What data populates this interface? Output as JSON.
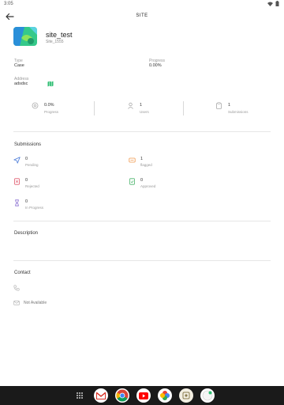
{
  "status_bar": {
    "time": "3:05"
  },
  "app_bar": {
    "title": "SITE"
  },
  "site": {
    "name": "site_test",
    "identifier": "Site_1555",
    "type_label": "Type",
    "type_value": "Case",
    "progress_label": "Progress",
    "progress_value": "0.00%",
    "address_label": "Address",
    "address_value": "adsdsc"
  },
  "stats": [
    {
      "value": "0.0%",
      "label": "Progress",
      "icon": "progress-icon"
    },
    {
      "value": "1",
      "label": "Users",
      "icon": "user-icon"
    },
    {
      "value": "1",
      "label": "Submissions",
      "icon": "clipboard-icon"
    }
  ],
  "submissions": {
    "title": "Submissions",
    "items": [
      {
        "count": "0",
        "label": "Pending",
        "icon": "send-icon",
        "color": "#4a7bd8"
      },
      {
        "count": "1",
        "label": "flagged",
        "icon": "flag-icon",
        "color": "#f0974b"
      },
      {
        "count": "0",
        "label": "Rejected",
        "icon": "rejected-doc-icon",
        "color": "#e05a6d"
      },
      {
        "count": "0",
        "label": "Approved",
        "icon": "approved-doc-icon",
        "color": "#4bb36b"
      },
      {
        "count": "0",
        "label": "In Progress",
        "icon": "hourglass-icon",
        "color": "#8a6fd1"
      }
    ]
  },
  "description": {
    "title": "Description"
  },
  "contact": {
    "title": "Contact",
    "email_value": "Not Available"
  },
  "colors": {
    "accent_green": "#2ebd72",
    "divider": "#e6e6e6"
  }
}
